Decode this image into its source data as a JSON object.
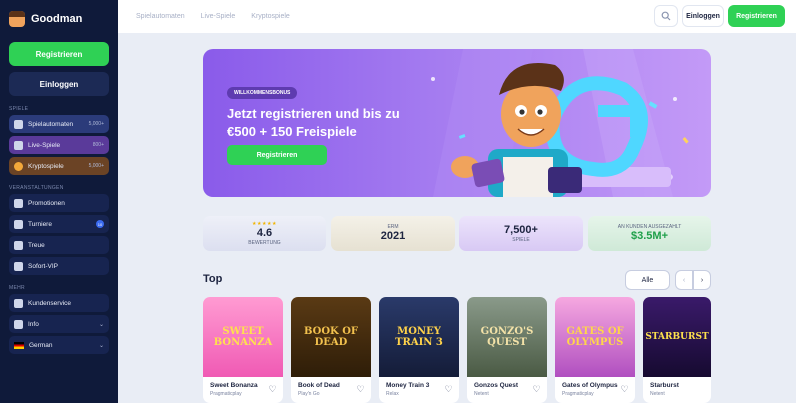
{
  "brand": {
    "name": "Goodman"
  },
  "sidebar": {
    "register_label": "Registrieren",
    "login_label": "Einloggen",
    "sections": {
      "games": "SPIELE",
      "organizer": "VERANSTALTUNGEN",
      "more": "MEHR"
    },
    "games": [
      {
        "label": "Spielautomaten",
        "count": "5,000+"
      },
      {
        "label": "Live-Spiele",
        "count": "800+"
      },
      {
        "label": "Kryptospiele",
        "count": "5,000+"
      }
    ],
    "events": [
      {
        "label": "Promotionen"
      },
      {
        "label": "Turniere",
        "badge": "10"
      },
      {
        "label": "Treue"
      },
      {
        "label": "Sofort-VIP"
      }
    ],
    "more": [
      {
        "label": "Kundenservice"
      },
      {
        "label": "Info"
      },
      {
        "label": "German"
      }
    ]
  },
  "topbar": {
    "links": [
      "Spielautomaten",
      "Live-Spiele",
      "Kryptospiele"
    ],
    "login_label": "Einloggen",
    "register_label": "Registrieren"
  },
  "hero": {
    "badge": "WILLKOMMENSBONUS",
    "title": "Jetzt registrieren und bis zu €500 + 150 Freispiele",
    "button": "Registrieren"
  },
  "stats": [
    {
      "rating": "4.6",
      "stars": "★★★★★",
      "label": "BEWERTUNG"
    },
    {
      "top": "ERM",
      "value": "2021"
    },
    {
      "value": "7,500+",
      "label": "SPIELE"
    },
    {
      "top": "AN KUNDEN AUSGEZAHLT",
      "value": "$3.5M+"
    }
  ],
  "top_section": {
    "title": "Top",
    "all_label": "Alle",
    "prev_label": "‹",
    "next_label": "›"
  },
  "games": [
    {
      "name": "Sweet Bonanza",
      "provider": "Pragmaticplay",
      "art": "SWEET BONANZA"
    },
    {
      "name": "Book of Dead",
      "provider": "Play'n Go",
      "art": "BOOK OF DEAD"
    },
    {
      "name": "Money Train 3",
      "provider": "Relax",
      "art": "MONEY TRAIN 3"
    },
    {
      "name": "Gonzos Quest",
      "provider": "Netent",
      "art": "GONZO'S QUEST"
    },
    {
      "name": "Gates of Olympus",
      "provider": "Pragmaticplay",
      "art": "GATES OF OLYMPUS"
    },
    {
      "name": "Starburst",
      "provider": "Netent",
      "art": "STARBURST"
    }
  ],
  "colors": {
    "accent_green": "#2fd155",
    "sidebar_bg": "#0f1a3a",
    "hero_purple": "#8a5bea"
  }
}
